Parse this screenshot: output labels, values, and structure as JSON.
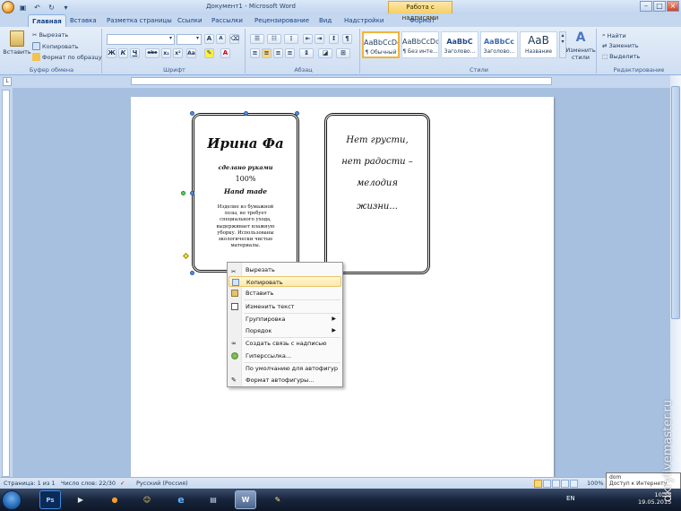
{
  "window": {
    "title": "Документ1 - Microsoft Word",
    "context_tab": "Работа с надписями"
  },
  "tabs": [
    "Главная",
    "Вставка",
    "Разметка страницы",
    "Ссылки",
    "Рассылки",
    "Рецензирование",
    "Вид",
    "Надстройки",
    "Формат"
  ],
  "ribbon": {
    "clipboard": {
      "paste": "Вставить",
      "cut": "Вырезать",
      "copy": "Копировать",
      "format_painter": "Формат по образцу",
      "label": "Буфер обмена"
    },
    "font": {
      "label": "Шрифт",
      "bold": "Ж",
      "italic": "К",
      "underline": "Ч",
      "abc": "abc",
      "sub": "x₂",
      "sup": "x²",
      "aa": "Aa",
      "grow": "A",
      "shrink": "A"
    },
    "paragraph": {
      "label": "Абзац",
      "pilcrow": "¶"
    },
    "styles": {
      "label": "Стили",
      "items": [
        {
          "preview": "AaBbCcDc",
          "name": "¶ Обычный"
        },
        {
          "preview": "AaBbCcDc",
          "name": "¶ Без инте..."
        },
        {
          "preview": "AaBbC",
          "name": "Заголово..."
        },
        {
          "preview": "AaBbCc",
          "name": "Заголово..."
        },
        {
          "preview": "AaB",
          "name": "Название"
        }
      ],
      "change_styles": "Изменить стили"
    },
    "editing": {
      "label": "Редактирование",
      "find": "Найти",
      "replace": "Заменить",
      "select": "Выделить"
    }
  },
  "document": {
    "label1": {
      "name": "Ирина Фа",
      "line1": "сделано руками",
      "line2": "100%",
      "line3": "Hand made",
      "desc": "Изделие из бумажной лозы, не требует специального ухода, выдерживает влажную уборку. Использованы экологически чистые материалы."
    },
    "label2": {
      "text": [
        "Нет грусти,",
        "нет радости –",
        "мелодия",
        "жизни..."
      ]
    }
  },
  "context_menu": [
    {
      "label": "Вырезать",
      "icon": "scissors-icon",
      "submenu": false,
      "highlight": false
    },
    {
      "label": "Копировать",
      "icon": "copy-icon",
      "submenu": false,
      "highlight": true
    },
    {
      "label": "Вставить",
      "icon": "paste-icon",
      "submenu": false,
      "highlight": false
    },
    {
      "label": "Изменить текст",
      "icon": "edit-text-icon",
      "submenu": false,
      "highlight": false
    },
    {
      "label": "Группировка",
      "icon": "",
      "submenu": true,
      "highlight": false
    },
    {
      "label": "Порядок",
      "icon": "",
      "submenu": true,
      "highlight": false
    },
    {
      "label": "Создать связь с надписью",
      "icon": "link-icon",
      "submenu": false,
      "highlight": false
    },
    {
      "label": "Гиперссылка...",
      "icon": "globe-icon",
      "submenu": false,
      "highlight": false
    },
    {
      "label": "По умолчанию для автофигур",
      "icon": "",
      "submenu": false,
      "highlight": false
    },
    {
      "label": "Формат автофигуры...",
      "icon": "format-icon",
      "submenu": false,
      "highlight": false
    }
  ],
  "status": {
    "page": "Страница: 1 из 1",
    "words": "Число слов: 22/30",
    "lang": "Русский (Россия)",
    "zoom": "100%"
  },
  "taskbar": {
    "lang": "EN",
    "time": "10:58",
    "date": "19.05.2015"
  },
  "tooltip": {
    "title": "dom",
    "text": "Доступ к Интернету"
  },
  "watermark": "dkrylivemaster.ru"
}
